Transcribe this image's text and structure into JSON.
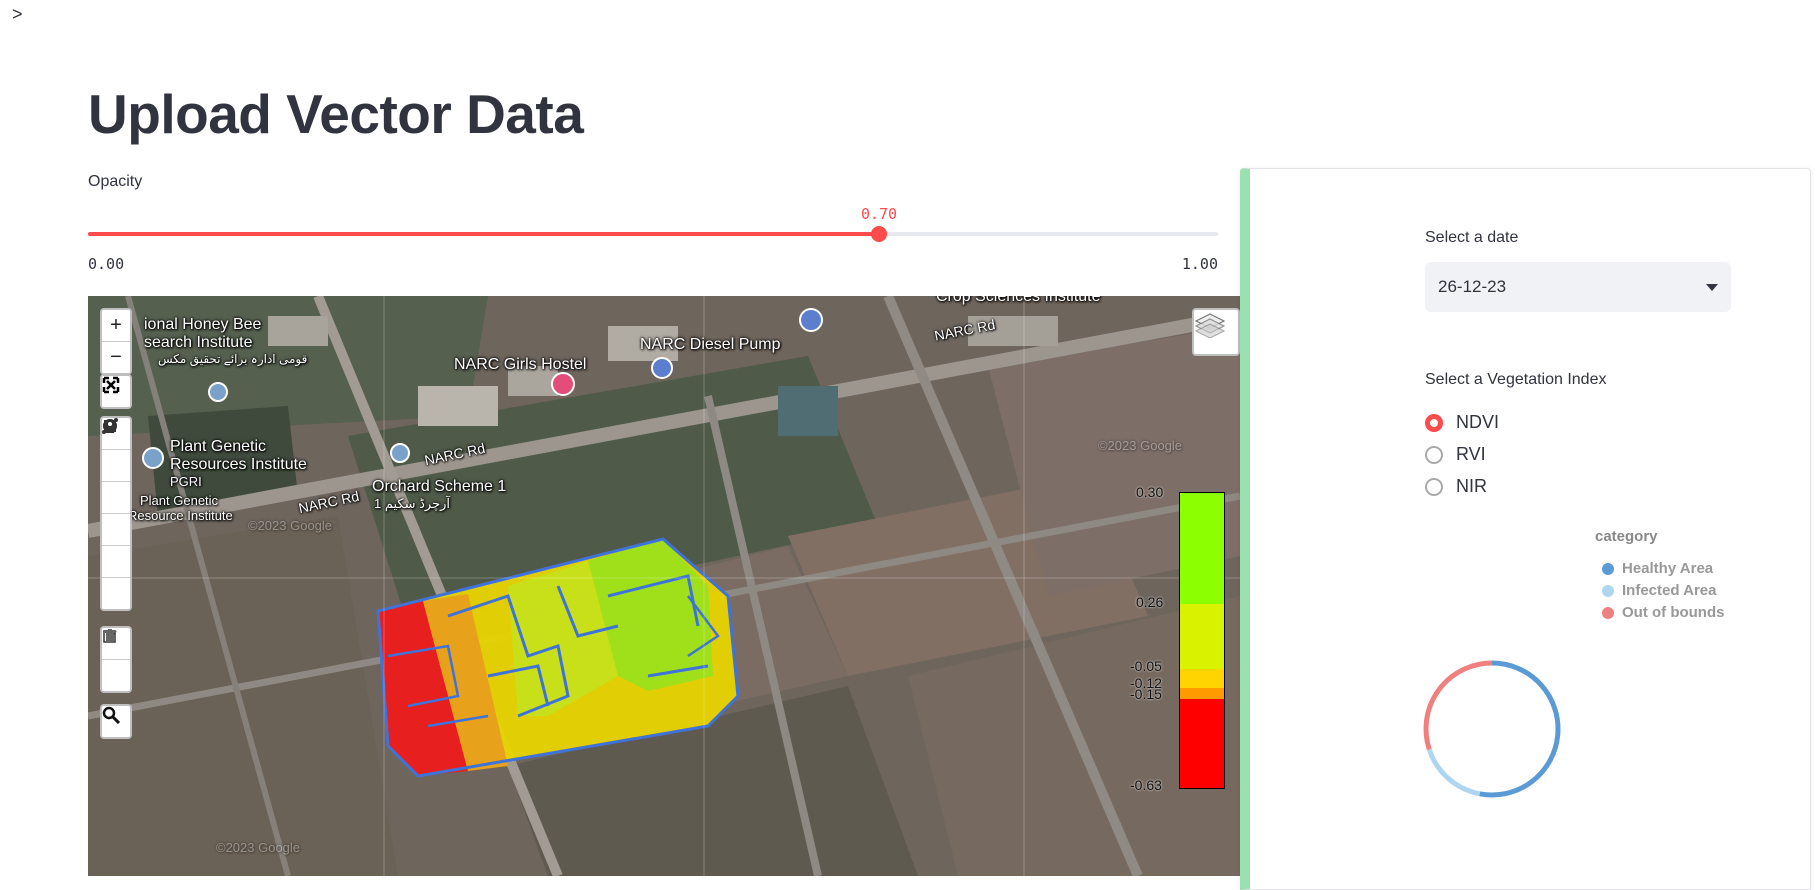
{
  "sidebar_toggle": ">",
  "page": {
    "title": "Upload Vector Data"
  },
  "opacity": {
    "label": "Opacity",
    "value": "0.70",
    "fraction": 0.7,
    "min": "0.00",
    "max": "1.00"
  },
  "map": {
    "labels": {
      "honey_bee_1": "ional Honey Bee",
      "honey_bee_2": "search Institute",
      "honey_bee_urdu": "قومی ادارہ برائے تحقیق مکس",
      "girls_hostel": "NARC Girls Hostel",
      "diesel_pump": "NARC Diesel Pump",
      "crop_sciences": "Crop Sciences Institute",
      "narc_rd_1": "NARC Rd",
      "narc_rd_2": "NARC Rd",
      "narc_rd_3": "NARC Rd",
      "plant_genetic_1": "Plant Genetic",
      "plant_genetic_2": "Resources Institute",
      "pgri": "PGRI",
      "plant_genetic_small_1": "Plant Genetic",
      "plant_genetic_small_2": "Resource Institute",
      "orchard": "Orchard Scheme 1",
      "orchard_urdu": "آرچرڈ سکیم 1",
      "watermark_1": "©2023 Google",
      "watermark_2": "©2023 Google",
      "watermark_3": "©2023 Google"
    },
    "colorbar": {
      "ticks": [
        "0.30",
        "0.26",
        "-0.05",
        "-0.12",
        "-0.15",
        "-0.63"
      ],
      "colors": [
        "#8cff00",
        "#d9f200",
        "#ffd400",
        "#ff9a00",
        "#ff0000"
      ]
    },
    "controls": {
      "zoom_in": "+",
      "zoom_out": "−"
    }
  },
  "panel": {
    "date_label": "Select a date",
    "date_value": "26-12-23",
    "vi_label": "Select a Vegetation Index",
    "vi_options": [
      "NDVI",
      "RVI",
      "NIR"
    ],
    "vi_selected": "NDVI",
    "legend_title": "category",
    "legend": [
      {
        "label": "Healthy Area",
        "color": "#5b9bd5"
      },
      {
        "label": "Infected Area",
        "color": "#aed6f1"
      },
      {
        "label": "Out of bounds",
        "color": "#f08080"
      }
    ],
    "donut": [
      {
        "category": "Healthy Area",
        "share": 0.53,
        "color": "#5b9bd5"
      },
      {
        "category": "Infected Area",
        "share": 0.17,
        "color": "#aed6f1"
      },
      {
        "category": "Out of bounds",
        "share": 0.3,
        "color": "#f08080"
      }
    ]
  }
}
